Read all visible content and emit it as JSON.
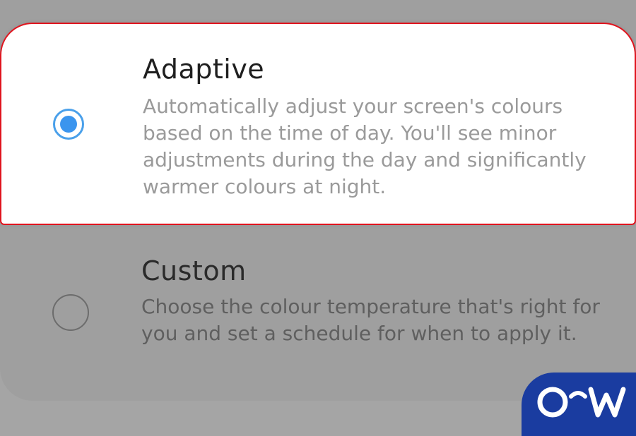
{
  "options": [
    {
      "title": "Adaptive",
      "description": "Automatically adjust your screen's colours based on the time of day. You'll see minor adjustments during the day and significantly warmer colours at night.",
      "selected": true
    },
    {
      "title": "Custom",
      "description": "Choose the colour temperature that's right for you and set a schedule for when to apply it.",
      "selected": false
    }
  ],
  "colors": {
    "highlight_border": "#e0141e",
    "radio_selected": "#3b95ee",
    "watermark_bg": "#1a3ca0"
  },
  "watermark": {
    "text": "OW",
    "icon": "watermark-logo"
  }
}
